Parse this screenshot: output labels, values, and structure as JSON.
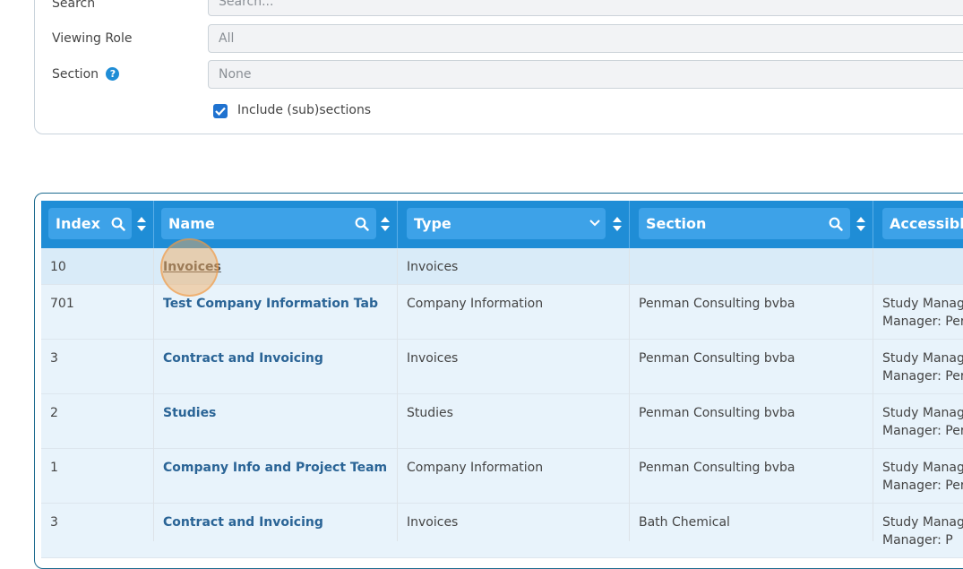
{
  "filters": {
    "search_label": "Search",
    "search_placeholder": "Search...",
    "role_label": "Viewing Role",
    "role_value": "All",
    "section_label": "Section",
    "section_value": "None",
    "include_label": "Include (sub)sections",
    "include_checked": true
  },
  "table": {
    "columns": [
      "Index",
      "Name",
      "Type",
      "Section",
      "Accessible"
    ],
    "rows": [
      {
        "index": "10",
        "name": "Invoices",
        "type": "Invoices",
        "section": "",
        "accessible_1": "",
        "accessible_2": ""
      },
      {
        "index": "701",
        "name": "Test Company Information Tab",
        "type": "Company Information",
        "section": "Penman Consulting bvba",
        "accessible_1": "Study Manag",
        "accessible_2": "Manager: Per"
      },
      {
        "index": "3",
        "name": "Contract and Invoicing",
        "type": "Invoices",
        "section": "Penman Consulting bvba",
        "accessible_1": "Study Manag",
        "accessible_2": "Manager: Per"
      },
      {
        "index": "2",
        "name": "Studies",
        "type": "Studies",
        "section": "Penman Consulting bvba",
        "accessible_1": "Study Manag",
        "accessible_2": "Manager: Per"
      },
      {
        "index": "1",
        "name": "Company Info and Project Team",
        "type": "Company Information",
        "section": "Penman Consulting bvba",
        "accessible_1": "Study Manag",
        "accessible_2": "Manager: Per"
      },
      {
        "index": "3",
        "name": "Contract and Invoicing",
        "type": "Invoices",
        "section": "Bath Chemical",
        "accessible_1": "Study Manag",
        "accessible_2": "Manager: P"
      }
    ]
  },
  "colors": {
    "header_bg": "#1f8dd6",
    "header_box": "#3da2e8",
    "row_highlight": "#d9ebf8",
    "row_bg": "#e8f3fb",
    "link": "#2a6496"
  }
}
